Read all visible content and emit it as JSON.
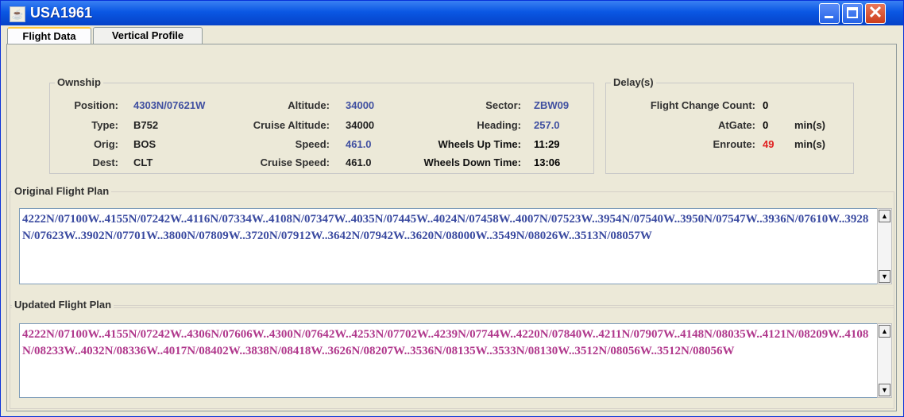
{
  "window": {
    "title": "USA1961",
    "app_icon": "java-cup-icon"
  },
  "tabs": [
    {
      "label": "Flight Data",
      "active": true
    },
    {
      "label": "Vertical Profile",
      "active": false
    }
  ],
  "ownship": {
    "legend": "Ownship",
    "position_label": "Position:",
    "position": "4303N/07621W",
    "type_label": "Type:",
    "type": "B752",
    "orig_label": "Orig:",
    "orig": "BOS",
    "dest_label": "Dest:",
    "dest": "CLT",
    "altitude_label": "Altitude:",
    "altitude": "34000",
    "cruise_altitude_label": "Cruise Altitude:",
    "cruise_altitude": "34000",
    "speed_label": "Speed:",
    "speed": "461.0",
    "cruise_speed_label": "Cruise Speed:",
    "cruise_speed": "461.0",
    "sector_label": "Sector:",
    "sector": "ZBW09",
    "heading_label": "Heading:",
    "heading": "257.0",
    "wheels_up_label": "Wheels Up Time:",
    "wheels_up": "11:29",
    "wheels_down_label": "Wheels Down Time:",
    "wheels_down": "13:06"
  },
  "delays": {
    "legend": "Delay(s)",
    "flight_change_count_label": "Flight Change Count:",
    "flight_change_count": "0",
    "at_gate_label": "AtGate:",
    "at_gate": "0",
    "at_gate_unit": "min(s)",
    "enroute_label": "Enroute:",
    "enroute": "49",
    "enroute_unit": "min(s)"
  },
  "original_plan": {
    "legend": "Original Flight Plan",
    "text": "4222N/07100W..4155N/07242W..4116N/07334W..4108N/07347W..4035N/07445W..4024N/07458W..4007N/07523W..3954N/07540W..3950N/07547W..3936N/07610W..3928N/07623W..3902N/07701W..3800N/07809W..3720N/07912W..3642N/07942W..3620N/08000W..3549N/08026W..3513N/08057W"
  },
  "updated_plan": {
    "legend": "Updated Flight Plan",
    "text": "4222N/07100W..4155N/07242W..4306N/07606W..4300N/07642W..4253N/07702W..4239N/07744W..4220N/07840W..4211N/07907W..4148N/08035W..4121N/08209W..4108N/08233W..4032N/08336W..4017N/08402W..3838N/08418W..3626N/08207W..3536N/08135W..3533N/08130W..3512N/08056W..3512N/08056W"
  },
  "colors": {
    "blue_value": "#3f4fa0",
    "red_value": "#e02020",
    "original_text": "#3a4aa0",
    "updated_text": "#b0388c"
  }
}
